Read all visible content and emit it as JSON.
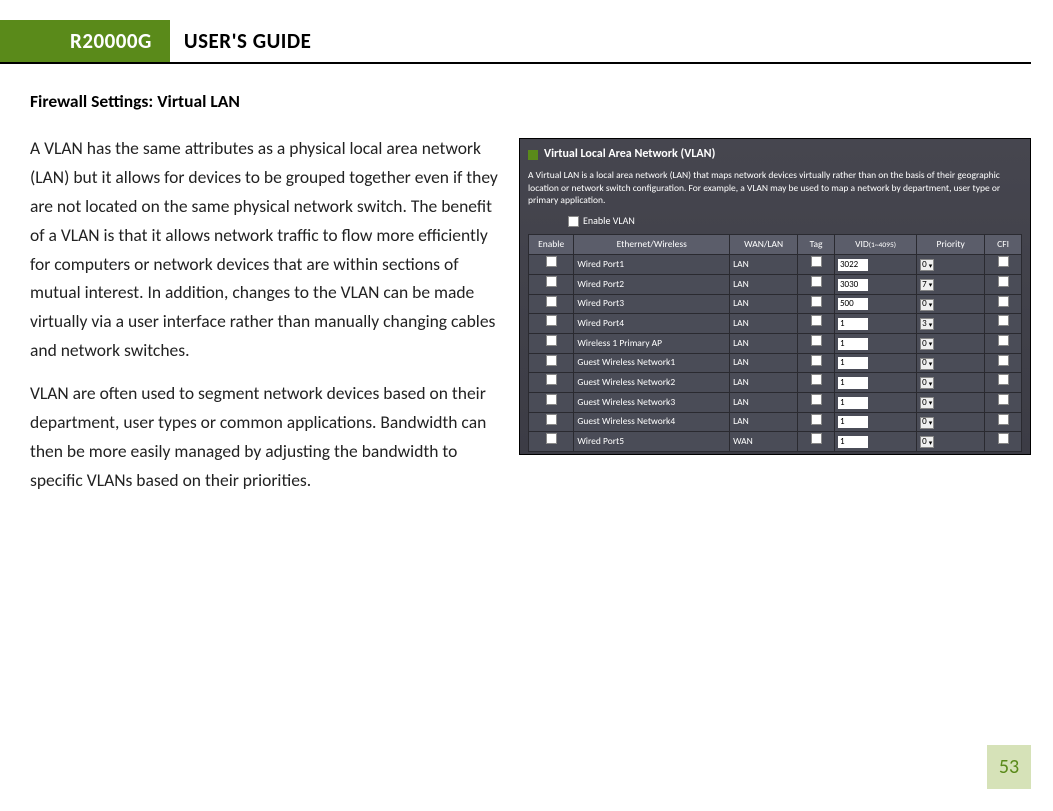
{
  "header": {
    "badge": "R20000G",
    "title": "USER'S GUIDE"
  },
  "section": {
    "heading": "Firewall Settings: Virtual LAN"
  },
  "paragraphs": {
    "p1": "A VLAN has the same attributes as a physical local area network (LAN) but it allows for devices to be grouped together even if they are not located on the same physical network switch.  The benefit of a VLAN is that it allows network traffic to flow more efficiently for computers or network devices that are within sections of mutual interest.  In addition, changes to the VLAN can be made virtually via a user interface rather than manually changing cables and network switches.",
    "p2": "VLAN are often used to segment network devices based on their department, user types or common applications.  Bandwidth can then be more easily managed by adjusting the bandwidth to specific VLANs based on their priorities."
  },
  "figure": {
    "title": "Virtual Local Area Network (VLAN)",
    "desc": "A Virtual LAN is a local area network (LAN) that maps network devices virtually rather than on the basis of their geographic location or network switch configuration. For example, a VLAN may be used to map a network by department, user type or primary application.",
    "enable_label": "Enable VLAN",
    "columns": {
      "enable": "Enable",
      "eth": "Ethernet/Wireless",
      "wanlan": "WAN/LAN",
      "tag": "Tag",
      "vid": "VID",
      "vid_range": "(1~4095)",
      "priority": "Priority",
      "cfi": "CFI"
    },
    "rows": [
      {
        "name": "Wired Port1",
        "wl": "LAN",
        "vid": "3022",
        "pri": "0"
      },
      {
        "name": "Wired Port2",
        "wl": "LAN",
        "vid": "3030",
        "pri": "7"
      },
      {
        "name": "Wired Port3",
        "wl": "LAN",
        "vid": "500",
        "pri": "0"
      },
      {
        "name": "Wired Port4",
        "wl": "LAN",
        "vid": "1",
        "pri": "3"
      },
      {
        "name": "Wireless 1 Primary AP",
        "wl": "LAN",
        "vid": "1",
        "pri": "0"
      },
      {
        "name": "Guest Wireless Network1",
        "wl": "LAN",
        "vid": "1",
        "pri": "0"
      },
      {
        "name": "Guest Wireless Network2",
        "wl": "LAN",
        "vid": "1",
        "pri": "0"
      },
      {
        "name": "Guest Wireless Network3",
        "wl": "LAN",
        "vid": "1",
        "pri": "0"
      },
      {
        "name": "Guest Wireless Network4",
        "wl": "LAN",
        "vid": "1",
        "pri": "0"
      },
      {
        "name": "Wired Port5",
        "wl": "WAN",
        "vid": "1",
        "pri": "0"
      }
    ]
  },
  "page_number": "53"
}
